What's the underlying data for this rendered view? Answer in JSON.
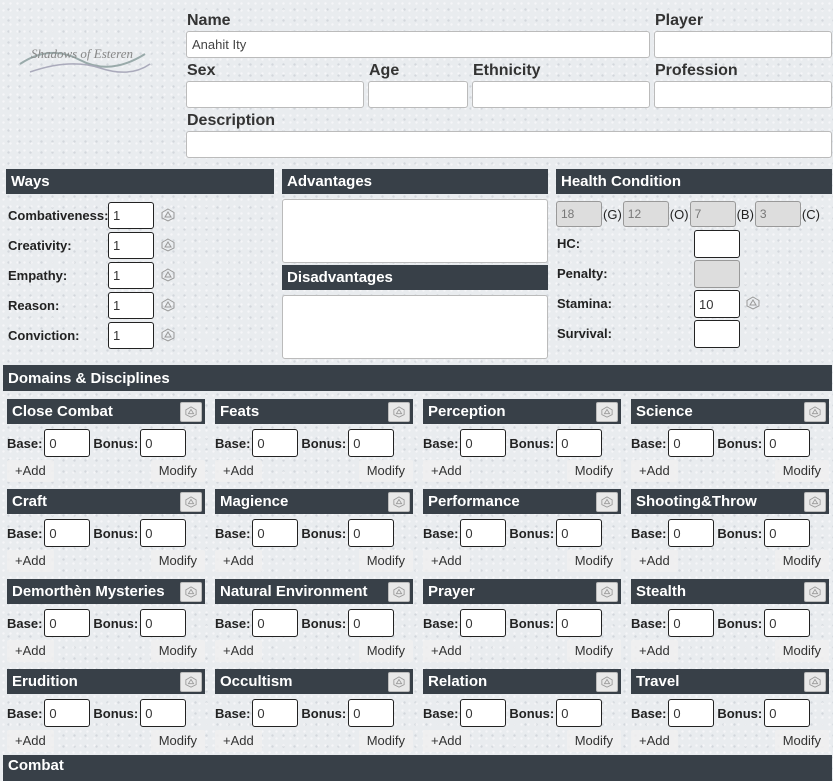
{
  "header": {
    "logo_text": "Shadows of Esteren",
    "name_label": "Name",
    "name_value": "Anahit Ity",
    "player_label": "Player",
    "player_value": "",
    "sex_label": "Sex",
    "age_label": "Age",
    "ethnicity_label": "Ethnicity",
    "profession_label": "Profession",
    "description_label": "Description"
  },
  "ways": {
    "title": "Ways",
    "items": [
      {
        "label": "Combativeness:",
        "value": "1"
      },
      {
        "label": "Creativity:",
        "value": "1"
      },
      {
        "label": "Empathy:",
        "value": "1"
      },
      {
        "label": "Reason:",
        "value": "1"
      },
      {
        "label": "Conviction:",
        "value": "1"
      }
    ]
  },
  "advantages": {
    "title": "Advantages",
    "dis_title": "Disadvantages"
  },
  "health": {
    "title": "Health Condition",
    "boxes": [
      {
        "value": "18",
        "tag": "(G)"
      },
      {
        "value": "12",
        "tag": "(O)"
      },
      {
        "value": "7",
        "tag": "(B)"
      },
      {
        "value": "3",
        "tag": "(C)"
      }
    ],
    "hc_label": "HC:",
    "hc_value": "",
    "penalty_label": "Penalty:",
    "penalty_value": "",
    "stamina_label": "Stamina:",
    "stamina_value": "10",
    "survival_label": "Survival:",
    "survival_value": ""
  },
  "domains": {
    "title": "Domains & Disciplines",
    "base_label": "Base:",
    "bonus_label": "Bonus:",
    "add_label": "+Add",
    "modify_label": "Modify",
    "items": [
      {
        "name": "Close Combat",
        "base": "0",
        "bonus": "0"
      },
      {
        "name": "Feats",
        "base": "0",
        "bonus": "0"
      },
      {
        "name": "Perception",
        "base": "0",
        "bonus": "0"
      },
      {
        "name": "Science",
        "base": "0",
        "bonus": "0"
      },
      {
        "name": "Craft",
        "base": "0",
        "bonus": "0"
      },
      {
        "name": "Magience",
        "base": "0",
        "bonus": "0"
      },
      {
        "name": "Performance",
        "base": "0",
        "bonus": "0"
      },
      {
        "name": "Shooting&Throw",
        "base": "0",
        "bonus": "0"
      },
      {
        "name": "Demorthèn Mysteries",
        "base": "0",
        "bonus": "0"
      },
      {
        "name": "Natural Environment",
        "base": "0",
        "bonus": "0"
      },
      {
        "name": "Prayer",
        "base": "0",
        "bonus": "0"
      },
      {
        "name": "Stealth",
        "base": "0",
        "bonus": "0"
      },
      {
        "name": "Erudition",
        "base": "0",
        "bonus": "0"
      },
      {
        "name": "Occultism",
        "base": "0",
        "bonus": "0"
      },
      {
        "name": "Relation",
        "base": "0",
        "bonus": "0"
      },
      {
        "name": "Travel",
        "base": "0",
        "bonus": "0"
      }
    ]
  },
  "combat": {
    "title": "Combat"
  }
}
